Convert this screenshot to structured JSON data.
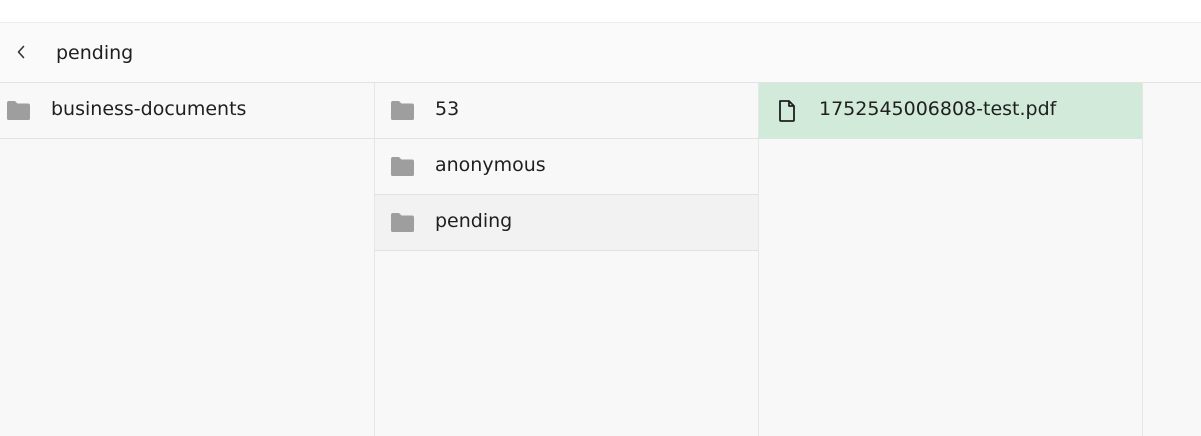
{
  "header": {
    "title": "pending"
  },
  "columns": {
    "col1": [
      {
        "label": "business-documents",
        "icon": "folder-icon"
      }
    ],
    "col2": [
      {
        "label": "53",
        "icon": "folder-icon"
      },
      {
        "label": "anonymous",
        "icon": "folder-icon"
      },
      {
        "label": "pending",
        "icon": "folder-icon",
        "active": true
      }
    ],
    "col3": [
      {
        "label": "1752545006808-test.pdf",
        "icon": "file-icon",
        "selected": true
      }
    ]
  },
  "colors": {
    "selected_row": "#d2ead9",
    "active_row": "#f2f2f2",
    "folder_icon": "#9e9e9e",
    "column_bg": "#f8f8f8"
  }
}
